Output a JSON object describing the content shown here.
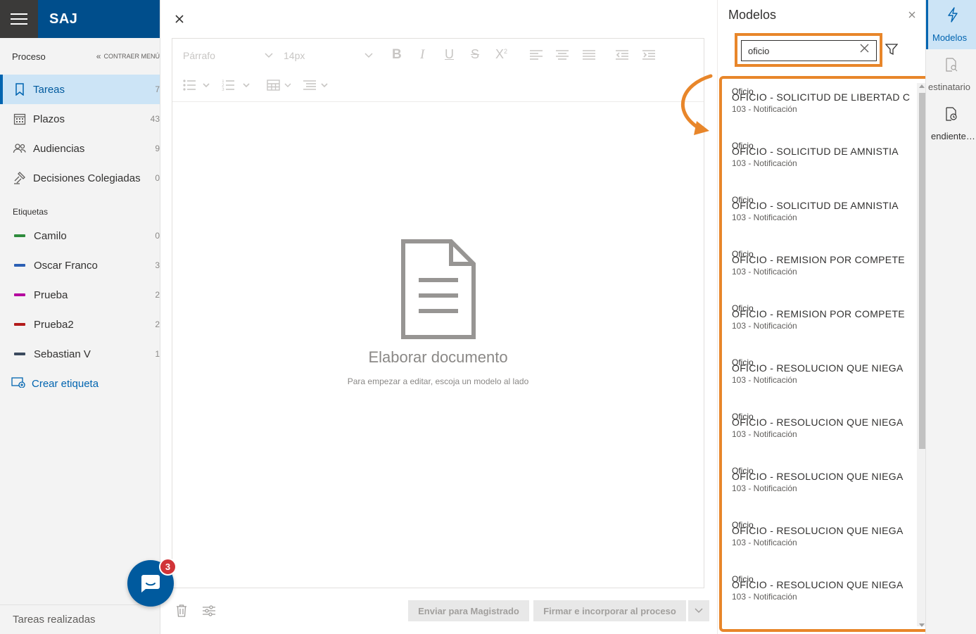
{
  "app": {
    "brand": "SAJ"
  },
  "sidebar": {
    "process_title": "Proceso",
    "collapse_label": "CONTRAER MENÚ",
    "nav": [
      {
        "label": "Tareas",
        "count": "7",
        "icon": "bookmark-icon"
      },
      {
        "label": "Plazos",
        "count": "43",
        "icon": "calendar-icon"
      },
      {
        "label": "Audiencias",
        "count": "9",
        "icon": "people-icon"
      },
      {
        "label": "Decisiones Colegiadas",
        "count": "0",
        "icon": "gavel-icon"
      }
    ],
    "tags_title": "Etiquetas",
    "tags": [
      {
        "label": "Camilo",
        "count": "0",
        "color": "#2e8b3c"
      },
      {
        "label": "Oscar Franco",
        "count": "3",
        "color": "#2b5fb4"
      },
      {
        "label": "Prueba",
        "count": "2",
        "color": "#b4009e"
      },
      {
        "label": "Prueba2",
        "count": "2",
        "color": "#b31b1b"
      },
      {
        "label": "Sebastian V",
        "count": "1",
        "color": "#3b4a5e"
      }
    ],
    "create_tag_label": "Crear etiqueta",
    "footer_label": "Tareas realizadas"
  },
  "chat": {
    "badge_count": "3"
  },
  "editor": {
    "toolbar": {
      "paragraph_label": "Párrafo",
      "font_size_label": "14px"
    },
    "empty_title": "Elaborar documento",
    "empty_subtitle": "Para empezar a editar, escoja un modelo al lado",
    "buttons": {
      "send_label": "Enviar para Magistrado",
      "sign_label": "Firmar e incorporar al proceso"
    }
  },
  "models_panel": {
    "title": "Modelos",
    "search_value": "oficio",
    "results": [
      {
        "category": "Oficio",
        "name": "OFICIO - SOLICITUD DE LIBERTAD C",
        "meta": "103 - Notificación"
      },
      {
        "category": "Oficio",
        "name": "OFICIO - SOLICITUD DE AMNISTIA",
        "meta": "103 - Notificación"
      },
      {
        "category": "Oficio",
        "name": "OFICIO - SOLICITUD DE AMNISTIA",
        "meta": "103 - Notificación"
      },
      {
        "category": "Oficio",
        "name": "OFICIO - REMISION POR COMPETE",
        "meta": "103 - Notificación"
      },
      {
        "category": "Oficio",
        "name": "OFICIO - REMISION POR COMPETE",
        "meta": "103 - Notificación"
      },
      {
        "category": "Oficio",
        "name": "OFICIO - RESOLUCION QUE NIEGA",
        "meta": "103 - Notificación"
      },
      {
        "category": "Oficio",
        "name": "OFICIO - RESOLUCION QUE NIEGA",
        "meta": "103 - Notificación"
      },
      {
        "category": "Oficio",
        "name": "OFICIO - RESOLUCION QUE NIEGA",
        "meta": "103 - Notificación"
      },
      {
        "category": "Oficio",
        "name": "OFICIO - RESOLUCION QUE NIEGA",
        "meta": "103 - Notificación"
      },
      {
        "category": "Oficio",
        "name": "OFICIO - RESOLUCION QUE NIEGA",
        "meta": "103 - Notificación"
      }
    ],
    "highlight_color": "#e8862a"
  },
  "rail": {
    "items": [
      {
        "label": "Modelos",
        "icon": "lightning-icon"
      },
      {
        "label": "estinatario",
        "icon": "document-search-icon"
      },
      {
        "label": "endiente…",
        "icon": "document-clock-icon"
      }
    ]
  }
}
